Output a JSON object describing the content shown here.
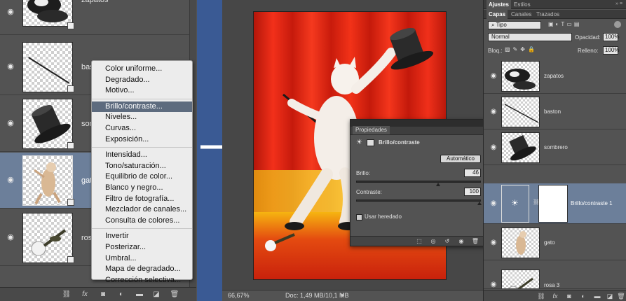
{
  "left_panel": {
    "layers": [
      {
        "name": "zapatos"
      },
      {
        "name": "baston"
      },
      {
        "name": "sombrero"
      },
      {
        "name": "gato"
      },
      {
        "name": "rosa 3"
      }
    ]
  },
  "adjustment_menu": {
    "groups": [
      [
        "Color uniforme...",
        "Degradado...",
        "Motivo..."
      ],
      [
        "Brillo/contraste...",
        "Niveles...",
        "Curvas...",
        "Exposición..."
      ],
      [
        "Intensidad...",
        "Tono/saturación...",
        "Equilibrio de color...",
        "Blanco y negro...",
        "Filtro de fotografía...",
        "Mezclador de canales...",
        "Consulta de colores..."
      ],
      [
        "Invertir",
        "Posterizar...",
        "Umbral...",
        "Mapa de degradado...",
        "Corrección selectiva..."
      ]
    ],
    "highlighted": "Brillo/contraste..."
  },
  "status_bar": {
    "zoom": "66,67%",
    "doc": "Doc: 1,49 MB/10,1 MB"
  },
  "properties": {
    "tab": "Propiedades",
    "title": "Brillo/contraste",
    "auto_button": "Automático",
    "brightness_label": "Brillo:",
    "brightness_value": "46",
    "brightness_level": 46,
    "contrast_label": "Contraste:",
    "contrast_value": "100",
    "contrast_level": 100,
    "legacy_label": "Usar heredado"
  },
  "right_panel": {
    "top_tabs": [
      "Ajustes",
      "Estilos"
    ],
    "layer_tabs": [
      "Capas",
      "Canales",
      "Trazados"
    ],
    "filter_select": "Tipo",
    "blend_mode": "Normal",
    "opacity_label": "Opacidad:",
    "opacity_value": "100%",
    "lock_label": "Bloq.:",
    "fill_label": "Relleno:",
    "fill_value": "100%",
    "layers": [
      {
        "name": "zapatos"
      },
      {
        "name": "baston"
      },
      {
        "name": "sombrero"
      },
      {
        "name": "Brillo/contraste 1"
      },
      {
        "name": "gato"
      },
      {
        "name": "rosa 3"
      }
    ]
  },
  "colors": {
    "selection": "#6c7f9a",
    "menu_highlight": "#5d6b7e",
    "blue_strip": "#3a5a94",
    "curtain_red": "#e8230f"
  }
}
